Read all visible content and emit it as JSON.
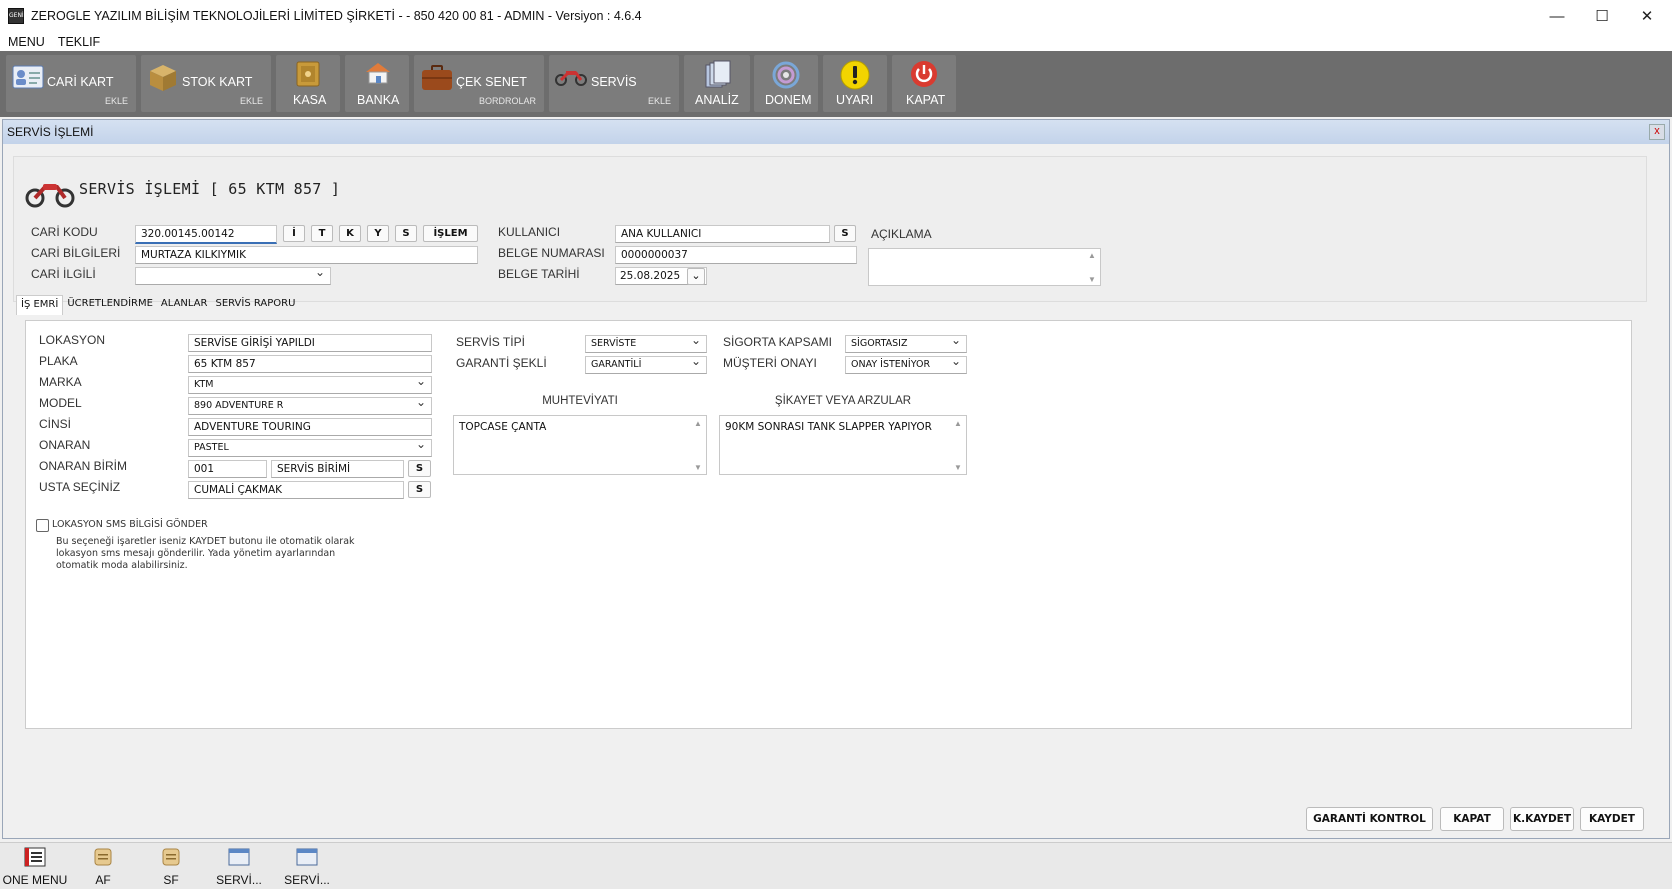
{
  "titlebar": {
    "title": "ZEROGLE YAZILIM BİLİŞİM TEKNOLOJİLERİ LİMİTED ŞİRKETİ -  - 850 420 00 81 - ADMIN -  Versiyon : 4.6.4",
    "app_icon_text": "GENİ",
    "minimize": "—",
    "maximize": "☐",
    "close": "✕"
  },
  "menubar": {
    "items": [
      "MENU",
      "TEKLIF"
    ]
  },
  "toolbar": {
    "buttons": [
      {
        "label": "CARİ KART",
        "sub": "EKLE",
        "icon": "card-icon"
      },
      {
        "label": "STOK KART",
        "sub": "EKLE",
        "icon": "box-icon"
      },
      {
        "label": "KASA",
        "sub": "",
        "icon": "safe-icon"
      },
      {
        "label": "BANKA",
        "sub": "",
        "icon": "bank-icon"
      },
      {
        "label": "ÇEK SENET",
        "sub": "BORDROLAR",
        "icon": "briefcase-icon"
      },
      {
        "label": "SERVİS",
        "sub": "EKLE",
        "icon": "motorcycle-icon"
      },
      {
        "label": "ANALİZ",
        "sub": "",
        "icon": "documents-icon"
      },
      {
        "label": "DONEM",
        "sub": "",
        "icon": "cycle-icon"
      },
      {
        "label": "UYARI",
        "sub": "",
        "icon": "warning-icon"
      },
      {
        "label": "KAPAT",
        "sub": "",
        "icon": "power-icon"
      }
    ]
  },
  "window": {
    "title": "SERVİS İŞLEMİ",
    "close": "x",
    "heading": "SERVİS İŞLEMİ [ 65 KTM 857 ]",
    "header": {
      "cari_kodu_label": "CARİ KODU",
      "cari_kodu_value": "320.00145.00142",
      "quick_buttons": [
        "İ",
        "T",
        "K",
        "Y",
        "S"
      ],
      "islem_button": "İŞLEM",
      "cari_bilgileri_label": "CARİ BİLGİLERİ",
      "cari_bilgileri_value": "MURTAZA KILKIYMIK",
      "cari_ilgili_label": "CARİ İLGİLİ",
      "cari_ilgili_value": "",
      "kullanici_label": "KULLANICI",
      "kullanici_value": "ANA KULLANICI",
      "kullanici_button": "S",
      "belge_no_label": "BELGE NUMARASI",
      "belge_no_value": "0000000037",
      "belge_tarihi_label": "BELGE TARİHİ",
      "belge_tarihi_value": "25.08.2025",
      "aciklama_label": "AÇIKLAMA",
      "aciklama_value": ""
    },
    "tabs": [
      "İŞ EMRİ",
      "ÜCRETLENDİRME",
      "ALANLAR",
      "SERVİS RAPORU"
    ],
    "is_emri": {
      "lokasyon_label": "LOKASYON",
      "lokasyon_value": "SERVİSE GİRİŞİ YAPILDI",
      "plaka_label": "PLAKA",
      "plaka_value": "65 KTM 857",
      "marka_label": "MARKA",
      "marka_value": "KTM",
      "model_label": "MODEL",
      "model_value": "890 ADVENTURE R",
      "cinsi_label": "CİNSİ",
      "cinsi_value": "ADVENTURE TOURING",
      "onaran_label": "ONARAN",
      "onaran_value": "PASTEL",
      "onaran_birim_label": "ONARAN BİRİM",
      "onaran_birim_code": "001",
      "onaran_birim_name": "SERVİS BİRİMİ",
      "onaran_birim_button": "S",
      "usta_label": "USTA SEÇİNİZ",
      "usta_value": "CUMALİ ÇAKMAK",
      "usta_button": "S",
      "servis_tipi_label": "SERVİS TİPİ",
      "servis_tipi_value": "SERVİSTE",
      "garanti_label": "GARANTİ ŞEKLİ",
      "garanti_value": "GARANTİLİ",
      "sigorta_label": "SİGORTA KAPSAMI",
      "sigorta_value": "SİGORTASIZ",
      "onay_label": "MÜŞTERİ ONAYI",
      "onay_value": "ONAY İSTENİYOR",
      "muhteviyat_label": "MUHTEVİYATI",
      "muhteviyat_value": "TOPCASE ÇANTA",
      "sikayet_label": "ŞİKAYET VEYA ARZULAR",
      "sikayet_value": "90KM SONRASI TANK SLAPPER YAPIYOR",
      "sms_label": "LOKASYON SMS BİLGİSİ GÖNDER",
      "sms_checked": false,
      "sms_note_1": "Bu seçeneği işaretler iseniz KAYDET butonu ile otomatik olarak",
      "sms_note_2": "lokasyon sms mesajı gönderilir. Yada yönetim ayarlarından",
      "sms_note_3": "otomatik moda alabilirsiniz."
    },
    "footer_buttons": [
      "GARANTİ KONTROL",
      "KAPAT",
      "K.KAYDET",
      "KAYDET"
    ]
  },
  "taskbar": {
    "items": [
      {
        "label": "ONE MENU",
        "icon": "menu-icon"
      },
      {
        "label": "AF",
        "icon": "scroll-icon"
      },
      {
        "label": "SF",
        "icon": "scroll-icon"
      },
      {
        "label": "SERVİ...",
        "icon": "window-icon"
      },
      {
        "label": "SERVİ...",
        "icon": "window-icon"
      }
    ]
  }
}
